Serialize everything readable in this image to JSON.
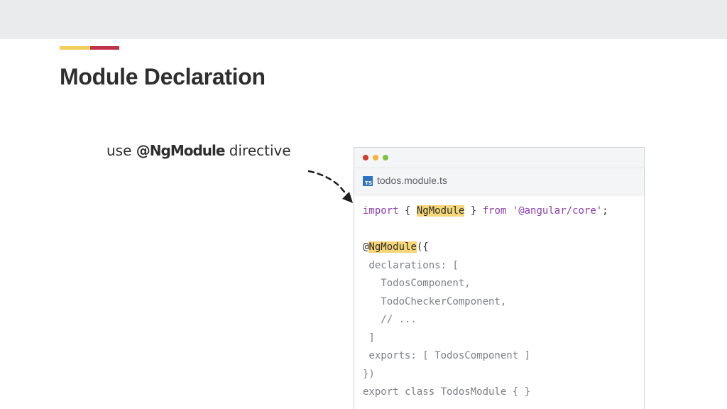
{
  "slide": {
    "title": "Module Declaration",
    "colors": {
      "accent_yellow": "#f2cf5b",
      "accent_red": "#c0314b",
      "highlight": "#f6d676"
    }
  },
  "annotation": {
    "prefix": "use ",
    "emphasis": "@NgModule",
    "suffix": " directive"
  },
  "editor": {
    "window_controls": [
      "close-dot",
      "minimize-dot",
      "maximize-dot"
    ],
    "tab": {
      "icon_text": "TS",
      "filename": "todos.module.ts"
    },
    "code": {
      "l1_import": "import",
      "l1_open": " { ",
      "l1_ngmodule": "NgModule",
      "l1_close": " } ",
      "l1_from": "from",
      "l1_space": " ",
      "l1_string": "'@angular/core'",
      "l1_semi": ";",
      "l3_at": "@",
      "l3_ngmodule": "NgModule",
      "l3_rest": "({",
      "l4": " declarations: [",
      "l5": "   TodosComponent,",
      "l6": "   TodoCheckerComponent,",
      "l7": "   // ...",
      "l8": " ]",
      "l9": " exports: [ TodosComponent ]",
      "l10": "})",
      "l11": "export class TodosModule { }"
    }
  }
}
